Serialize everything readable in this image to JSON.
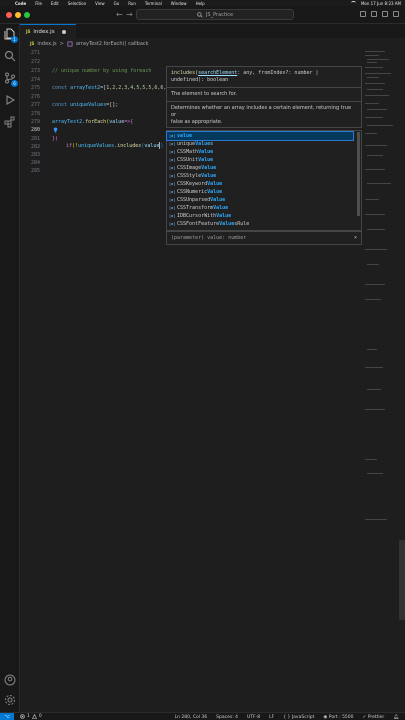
{
  "menubar": {
    "items": [
      "Code",
      "File",
      "Edit",
      "Selection",
      "View",
      "Go",
      "Run",
      "Terminal",
      "Window",
      "Help"
    ],
    "clock": "Mon 17 Jun  8:23 AM"
  },
  "titlebar": {
    "search_label": "JS_Practice"
  },
  "activity": {
    "explorer_badge": "1",
    "scm_badge": "6"
  },
  "tab": {
    "lang": "JS",
    "filename": "index.js"
  },
  "breadcrumb": {
    "lang": "JS",
    "file": "index.js",
    "separator": ">",
    "symbol": "arrayTest2.forEach() callback"
  },
  "editor": {
    "lines": [
      {
        "n": "271"
      },
      {
        "n": "272"
      },
      {
        "n": "273",
        "comment": "// unique number by using foreach"
      },
      {
        "n": "274"
      },
      {
        "n": "275",
        "kw": "const",
        "name": "arrayTest2",
        "eq": "=[",
        "nums": "1,2,2,3,4,5,5,5,6,6,"
      },
      {
        "n": "276"
      },
      {
        "n": "277",
        "kw": "const",
        "name": "uniqueValues",
        "rest": "=[];"
      },
      {
        "n": "278"
      },
      {
        "n": "279",
        "obj": "arrayTest2",
        "dot": ".",
        "fn": "forEach",
        "open": "(",
        "param": "value",
        "arrow": "=>{"
      },
      {
        "n": "280",
        "kw": "if",
        "open": "(!",
        "obj": "uniqueValues",
        "dot": ".",
        "fn": "includes",
        "paren": "(",
        "param": "value",
        "close": ")"
      },
      {
        "n": "281",
        "text": "})"
      },
      {
        "n": "282"
      },
      {
        "n": "283"
      },
      {
        "n": "284"
      },
      {
        "n": "285"
      }
    ]
  },
  "hover": {
    "sig1": "includes(",
    "sig_param": "searchElement",
    "sig2": ": any, fromIndex?: number |",
    "sig3": "undefined): boolean",
    "doc1": "The element to search for.",
    "doc2": "Determines whether an array includes a certain element, returning true or",
    "doc3": "false as appropriate."
  },
  "suggest": {
    "kind_label": "[ø]",
    "items": [
      {
        "pre": "",
        "hl": "value",
        "post": ""
      },
      {
        "pre": "unique",
        "hl": "Value",
        "post": "s"
      },
      {
        "pre": "CSSMath",
        "hl": "Value",
        "post": ""
      },
      {
        "pre": "CSSUnit",
        "hl": "Value",
        "post": ""
      },
      {
        "pre": "CSSImage",
        "hl": "Value",
        "post": ""
      },
      {
        "pre": "CSSStyle",
        "hl": "Value",
        "post": ""
      },
      {
        "pre": "CSSKeyword",
        "hl": "Value",
        "post": ""
      },
      {
        "pre": "CSSNumeric",
        "hl": "Value",
        "post": ""
      },
      {
        "pre": "CSSUnparsed",
        "hl": "Value",
        "post": ""
      },
      {
        "pre": "CSSTransform",
        "hl": "Value",
        "post": ""
      },
      {
        "pre": "IDBCursorWith",
        "hl": "Value",
        "post": ""
      },
      {
        "pre": "CSSFontFeature",
        "hl": "Value",
        "post": "sRule"
      }
    ],
    "detail": "(parameter) value: number",
    "close": "×"
  },
  "status": {
    "remote": "⌥",
    "errors": "1",
    "warnings": "0",
    "position": "Ln 280, Col 36",
    "spaces": "Spaces: 4",
    "encoding": "UTF-8",
    "eol": "LF",
    "language": "JavaScript",
    "port": "Port : 5500",
    "prettier": "Prettier"
  },
  "colors": {
    "accent": "#0078d4",
    "background": "#1e1e1e"
  }
}
